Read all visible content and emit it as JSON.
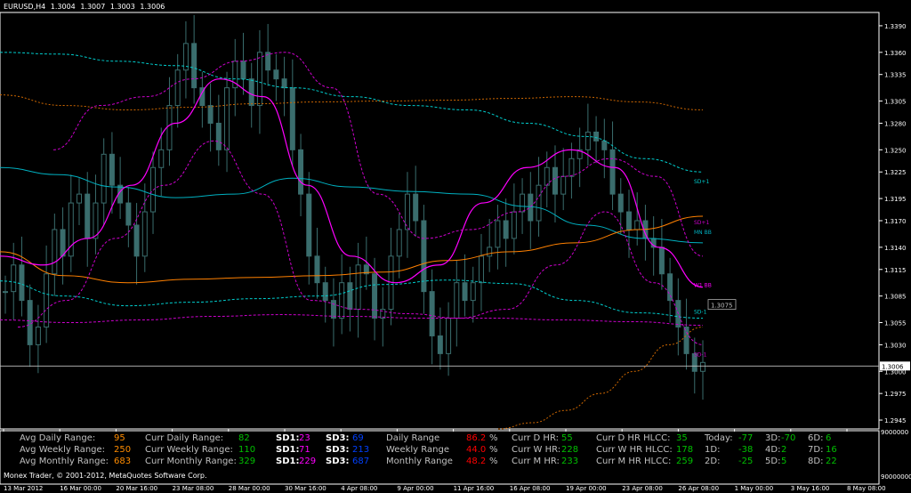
{
  "header": {
    "symbol": "EURUSD,H4",
    "open": "1.3004",
    "high": "1.3007",
    "low": "1.3003",
    "close": "1.3006"
  },
  "copyright": "Monex Trader, © 2001-2012, MetaQuotes Software Corp.",
  "colors": {
    "background": "#000000",
    "axis": "#ffffff",
    "candle": "#3a6d6d",
    "bands_upper_lower": "#cc00cc",
    "mid_line": "#ff00ff",
    "slow_ma": "#ff8000",
    "cyan_line": "#00b0c0",
    "cyan_dashed": "#00cccc",
    "orange_dotted": "#cc6600",
    "label_gray": "#c0c0c0",
    "label_orange": "#ff8c00",
    "value_green": "#00c000",
    "value_red": "#ff0000",
    "value_magenta": "#ff00ff",
    "value_blue": "#0040ff"
  },
  "chart_data": {
    "type": "line",
    "subtype": "candlestick price chart with indicator overlays",
    "price_axis_ticks": [
      "1.3390",
      "1.3360",
      "1.3335",
      "1.3305",
      "1.3280",
      "1.3250",
      "1.3225",
      "1.3195",
      "1.3170",
      "1.3140",
      "1.3115",
      "1.3085",
      "1.3055",
      "1.3030",
      "1.3000",
      "1.2975",
      "1.2945"
    ],
    "indicator_axis_ticks": [
      "9000000",
      "90000000"
    ],
    "time_axis_labels": [
      "13 Mar 2012",
      "16 Mar 00:00",
      "20 Mar 16:00",
      "23 Mar 08:00",
      "28 Mar 00:00",
      "30 Mar 16:00",
      "4 Apr 08:00",
      "9 Apr 00:00",
      "11 Apr 16:00",
      "16 Apr 08:00",
      "19 Apr 00:00",
      "23 Apr 08:00",
      "26 Apr 08:00",
      "1 May 00:00",
      "3 May 16:00",
      "8 May 08:00"
    ],
    "ylim": [
      1.2935,
      1.3405
    ],
    "current_price_label": "1.3006",
    "marker_price_label": "1.3075",
    "price_close_series": [
      1.309,
      1.312,
      1.308,
      1.303,
      1.305,
      1.311,
      1.316,
      1.313,
      1.319,
      1.32,
      1.315,
      1.319,
      1.3245,
      1.321,
      1.319,
      1.3165,
      1.313,
      1.318,
      1.323,
      1.325,
      1.33,
      1.334,
      1.337,
      1.332,
      1.33,
      1.328,
      1.325,
      1.332,
      1.335,
      1.333,
      1.33,
      1.336,
      1.334,
      1.333,
      1.332,
      1.325,
      1.32,
      1.313,
      1.31,
      1.308,
      1.306,
      1.31,
      1.307,
      1.312,
      1.311,
      1.306,
      1.307,
      1.313,
      1.316,
      1.32,
      1.317,
      1.309,
      1.304,
      1.302,
      1.306,
      1.31,
      1.308,
      1.31,
      1.313,
      1.314,
      1.317,
      1.315,
      1.318,
      1.32,
      1.317,
      1.321,
      1.323,
      1.32,
      1.322,
      1.324,
      1.325,
      1.327,
      1.326,
      1.325,
      1.32,
      1.318,
      1.316,
      1.317,
      1.315,
      1.314,
      1.311,
      1.308,
      1.305,
      1.302,
      1.3,
      1.301
    ],
    "series": [
      {
        "label_on_chart": "SD+1",
        "color": "#00cccc",
        "style": "dashed"
      },
      {
        "label_on_chart": "MN BB",
        "color": "#00b0c0",
        "style": "solid"
      },
      {
        "label_on_chart": "SD+1",
        "color": "#cc00cc",
        "style": "dashed"
      },
      {
        "label_on_chart": "W1 BB",
        "color": "#ff00ff",
        "style": "solid"
      },
      {
        "label_on_chart": "SD-1",
        "color": "#00cccc",
        "style": "dashed"
      },
      {
        "label_on_chart": "SD-1",
        "color": "#cc00cc",
        "style": "dashed"
      }
    ]
  },
  "stats": {
    "avg_daily_label": "Avg Daily Range:",
    "avg_daily": "95",
    "avg_weekly_label": "Avg Weekly Range:",
    "avg_weekly": "250",
    "avg_monthly_label": "Avg Monthly Range:",
    "avg_monthly": "683",
    "curr_daily_label": "Curr Daily Range:",
    "curr_daily": "82",
    "curr_weekly_label": "Curr Weekly Range:",
    "curr_weekly": "110",
    "curr_monthly_label": "Curr Monthly Range:",
    "curr_monthly": "329",
    "sd1_label": "SD1:",
    "sd1_d": "23",
    "sd1_w": "71",
    "sd1_m": "229",
    "sd3_label": "SD3:",
    "sd3_d": "69",
    "sd3_w": "213",
    "sd3_m": "687",
    "daily_range_label": "Daily Range",
    "daily_range": "86.2",
    "weekly_range_label": "Weekly Range",
    "weekly_range": "44.0",
    "monthly_range_label": "Monthly Range",
    "monthly_range": "48.2",
    "pct": "%",
    "curr_d_hr_label": "Curr D HR:",
    "curr_d_hr": "55",
    "curr_w_hr_label": "Curr W HR:",
    "curr_w_hr": "228",
    "curr_m_hr_label": "Curr M HR:",
    "curr_m_hr": "233",
    "curr_d_hlcc_label": "Curr D HR HLCC:",
    "curr_d_hlcc": "35",
    "curr_w_hlcc_label": "Curr W HR HLCC:",
    "curr_w_hlcc": "178",
    "curr_m_hlcc_label": "Curr M HR HLCC:",
    "curr_m_hlcc": "259",
    "today_label": "Today:",
    "today": "-77",
    "d1_label": "1D:",
    "d1": "-38",
    "d2_label": "2D:",
    "d2": "-25",
    "d3_label": "3D:",
    "d3": "-70",
    "d4_label": "4D:",
    "d4": "2",
    "d5_label": "5D:",
    "d5": "5",
    "d6_label": "6D:",
    "d6": "6",
    "d7_label": "7D:",
    "d7": "16",
    "d8_label": "8D:",
    "d8": "22"
  }
}
